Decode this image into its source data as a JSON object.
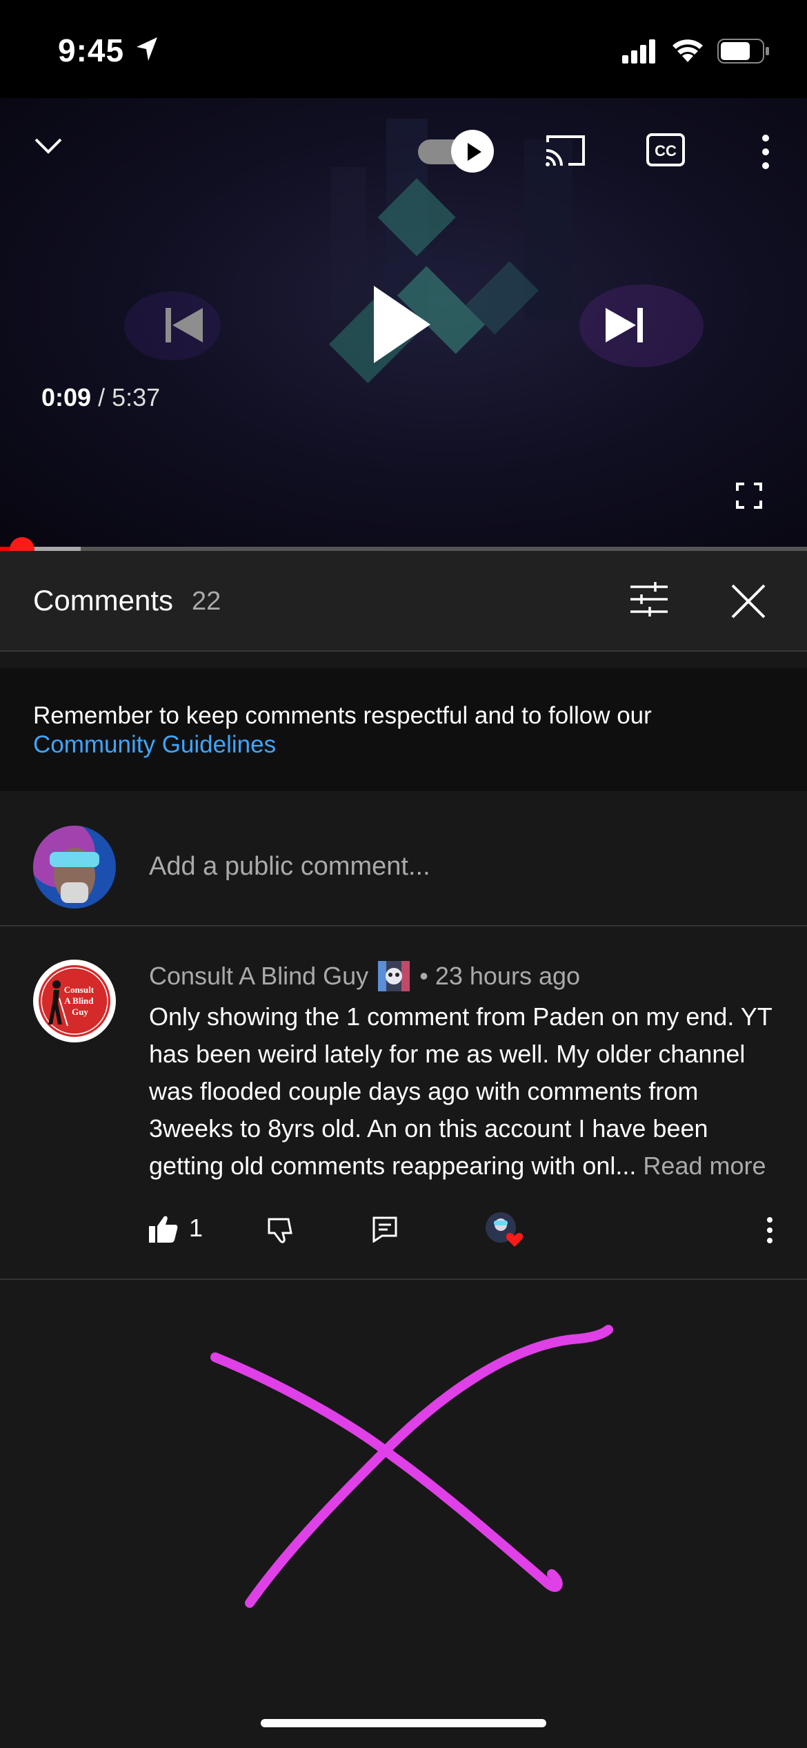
{
  "status_bar": {
    "time": "9:45"
  },
  "player": {
    "current_time": "0:09",
    "separator": " / ",
    "duration": "5:37",
    "progress_fraction": 0.027,
    "buffer_fraction": 0.1
  },
  "comments_panel": {
    "title": "Comments",
    "count": "22"
  },
  "notice": {
    "text": "Remember to keep comments respectful and to follow our",
    "link": "Community Guidelines"
  },
  "add_comment": {
    "placeholder": "Add a public comment..."
  },
  "comment": {
    "avatar_text": "Consult A Blind Guy",
    "author": "Consult A Blind Guy",
    "separator": "•",
    "time": "23 hours ago",
    "body": "Only showing the 1 comment from Paden on my end.  YT has been weird lately for me as well. My older channel was flooded couple days ago with comments from 3weeks to 8yrs old. An on this account I have been getting old comments reappearing with onl...",
    "read_more": "Read more",
    "like_count": "1"
  },
  "colors": {
    "accent_red": "#ff0000",
    "link_blue": "#3ea6ff",
    "annotation_magenta": "#e040e8"
  }
}
